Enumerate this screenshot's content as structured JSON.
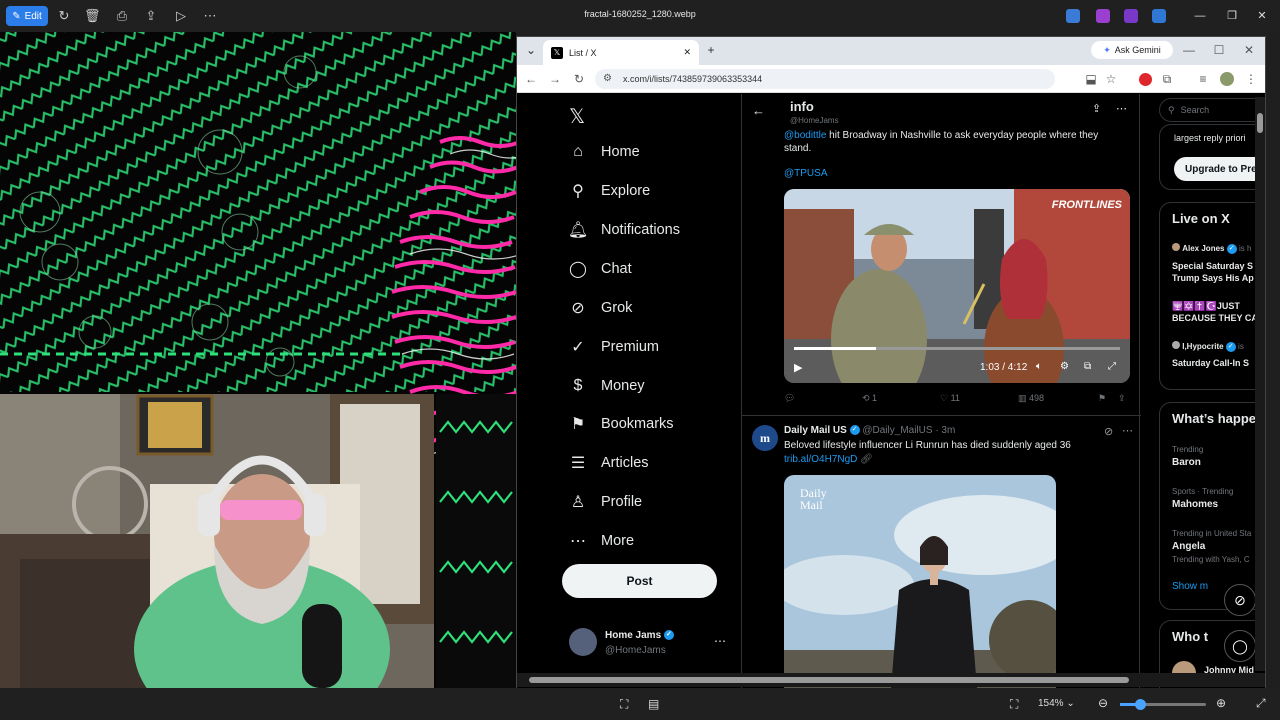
{
  "viewer": {
    "edit_label": "Edit",
    "file_title": "fractal-1680252_1280.webp",
    "zoom": "154%"
  },
  "browser": {
    "tab_title": "List / X",
    "url": "x.com/i/lists/743859739063353344",
    "gemini_label": "Ask Gemini"
  },
  "nav": {
    "items": [
      {
        "label": "Home",
        "icon": "home-icon"
      },
      {
        "label": "Explore",
        "icon": "search-icon"
      },
      {
        "label": "Notifications",
        "icon": "bell-icon"
      },
      {
        "label": "Chat",
        "icon": "chat-icon"
      },
      {
        "label": "Grok",
        "icon": "grok-icon"
      },
      {
        "label": "Premium",
        "icon": "premium-icon"
      },
      {
        "label": "Money",
        "icon": "money-icon"
      },
      {
        "label": "Bookmarks",
        "icon": "bookmark-icon"
      },
      {
        "label": "Articles",
        "icon": "articles-icon"
      },
      {
        "label": "Profile",
        "icon": "profile-icon"
      },
      {
        "label": "More",
        "icon": "more-icon"
      }
    ],
    "post_label": "Post",
    "account_name": "Home Jams",
    "account_handle": "@HomeJams"
  },
  "feed": {
    "header_title": "info",
    "header_handle": "@HomeJams",
    "tweet1": {
      "mention": "@bodittle",
      "text": " hit Broadway in Nashville to ask everyday people where they stand.",
      "tag": "@TPUSA",
      "video_brand": "FRONTLINES",
      "video_time": "1:03 / 4:12",
      "replies": "",
      "retweets": "1",
      "likes": "11",
      "views": "498"
    },
    "tweet2": {
      "name": "Daily Mail US",
      "handle": "@Daily_MailUS · 3m",
      "text": "Beloved lifestyle influencer Li Runrun has died suddenly aged 36",
      "link": "trib.al/O4H7NgD",
      "image_brand": "Daily Mail"
    }
  },
  "right": {
    "search_placeholder": "Search",
    "premium_text": "largest reply priori",
    "upgrade_label": "Upgrade to Pre",
    "live_title": "Live on X",
    "live": [
      {
        "host": "Alex Jones",
        "title": "Special Saturday S Trump Says His Ap"
      },
      {
        "host": "",
        "title": "🕎✡️✝️☪️JUST BECAUSE THEY CA"
      },
      {
        "host": "I,Hypocrite",
        "title": "Saturday Call-In S"
      }
    ],
    "happening_title": "What’s happe",
    "trends": [
      {
        "meta": "Trending",
        "name": "Baron",
        "sub": ""
      },
      {
        "meta": "Sports · Trending",
        "name": "Mahomes",
        "sub": ""
      },
      {
        "meta": "Trending in United Sta",
        "name": "Angela",
        "sub": "Trending with Yash, C"
      }
    ],
    "show_more": "Show m",
    "who_title": "Who t",
    "who_name": "Johnny Mid"
  },
  "colors": {
    "accent": "#1d9bf0",
    "viewer_accent": "#2b7de9"
  }
}
